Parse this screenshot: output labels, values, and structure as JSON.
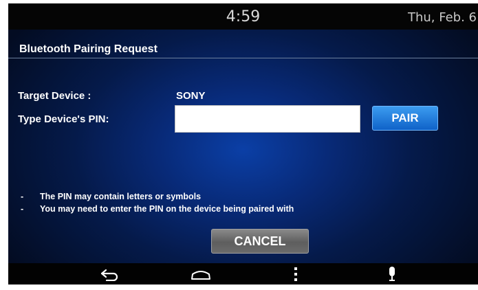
{
  "statusbar": {
    "time": "4:59",
    "date": "Thu, Feb. 6"
  },
  "dialog": {
    "title": "Bluetooth Pairing Request",
    "target_label": "Target Device :",
    "target_value": "SONY",
    "pin_label": "Type Device's PIN:",
    "pin_value": "",
    "pin_placeholder": "",
    "pair_label": "PAIR",
    "notes": [
      {
        "dash": "-",
        "text": "The PIN may contain letters  or symbols"
      },
      {
        "dash": "-",
        "text": "You may need to enter the PIN on the device being paired with"
      }
    ],
    "cancel_label": "CANCEL"
  },
  "navbar": {
    "icons": [
      "back-icon",
      "home-icon",
      "menu-icon",
      "microphone-icon"
    ]
  },
  "colors": {
    "background_center": "#0b3fa6",
    "pair_button": "#1f7de0",
    "cancel_button": "#6b6b6b"
  }
}
